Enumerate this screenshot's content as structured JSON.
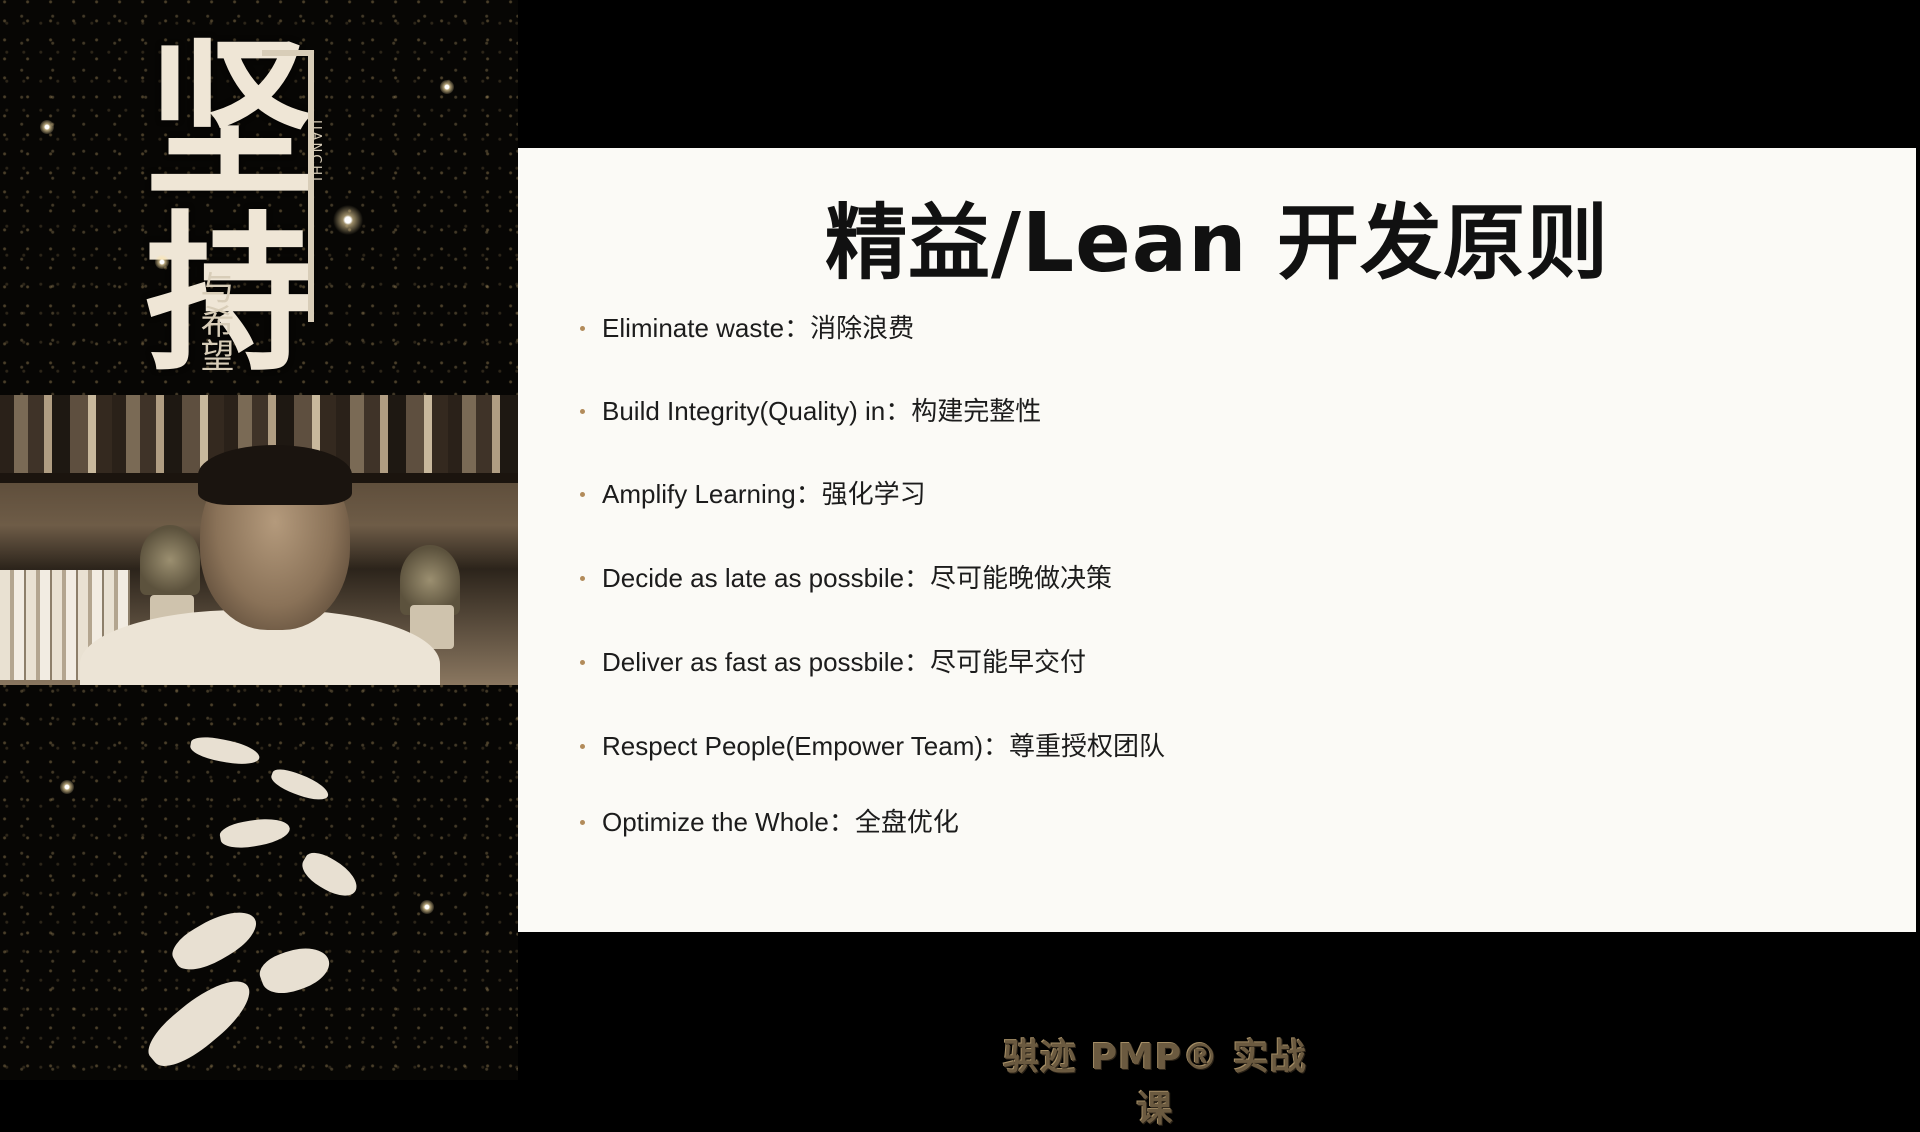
{
  "poster": {
    "title_main": "坚持",
    "pinyin": "JIANCHI",
    "subtitle": "与希望"
  },
  "slide": {
    "title": "精益/Lean 开发原则",
    "bullets": [
      "Eliminate waste：消除浪费",
      "Build Integrity(Quality) in：构建完整性",
      "Amplify Learning：强化学习",
      "Decide as late as possbile：尽可能晚做决策",
      "Deliver as fast as possbile：尽可能早交付",
      "Respect People(Empower Team)：尊重授权团队",
      "Optimize the Whole：全盘优化"
    ]
  },
  "footer": {
    "brand": "骐迹 PMP® 实战课"
  }
}
